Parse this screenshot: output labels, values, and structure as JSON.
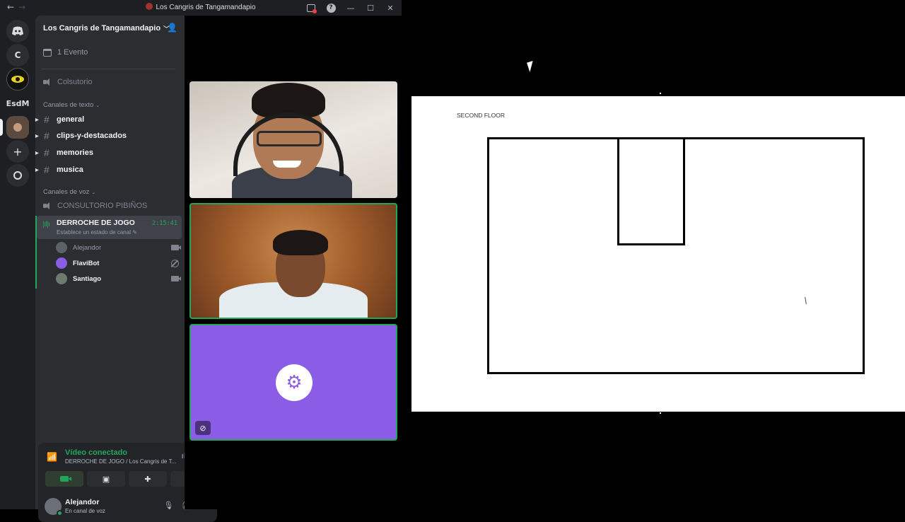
{
  "window": {
    "title": "Los Cangris de Tangamandapio",
    "nav_back": "←",
    "nav_forward": "→",
    "minimize": "—",
    "maximize": "☐",
    "close": "✕",
    "help": "?"
  },
  "rail": {
    "items": [
      {
        "label": "C",
        "icon": "server-letter"
      },
      {
        "label": "",
        "icon": "eye-server-icon"
      },
      {
        "label": "EsdM",
        "icon": "server-text"
      },
      {
        "label": "",
        "icon": "active-server-avatar"
      },
      {
        "label": "+",
        "icon": "add-server-icon"
      },
      {
        "label": "",
        "icon": "explore-icon"
      }
    ]
  },
  "server": {
    "name": "Los Cangris de Tangamandapio",
    "events": "1 Evento",
    "top_voice_channel": "Colsutorio",
    "text_category": "Canales de texto",
    "text_channels": [
      "general",
      "clips-y-destacados",
      "memories",
      "musica"
    ],
    "voice_category": "Canales de voz",
    "voice_channels": [
      "CONSULTORIO PIBIÑOS"
    ],
    "active_voice": {
      "name": "DERROCHE DE JOGO",
      "status": "Establece un estado de canal",
      "timer": "2:15:41"
    },
    "members": [
      {
        "name": "Alejandor",
        "state": "camera",
        "color": "#949ba4"
      },
      {
        "name": "FlaviBot",
        "state": "no-video",
        "color": "#f2f3f5"
      },
      {
        "name": "Santiago",
        "state": "camera",
        "color": "#f2f3f5"
      }
    ]
  },
  "rtc": {
    "status": "Vídeo conectado",
    "location": "DERROCHE DE JOGO / Los Cangris de T..."
  },
  "user": {
    "name": "Alejandor",
    "status": "En canal de voz"
  },
  "board": {
    "label": "SECOND FLOOR"
  },
  "colors": {
    "accent_green": "#23a55a",
    "bot_tile": "#8b5ce6",
    "sidebar_bg": "#2b2d31",
    "rail_bg": "#1e1f22"
  }
}
